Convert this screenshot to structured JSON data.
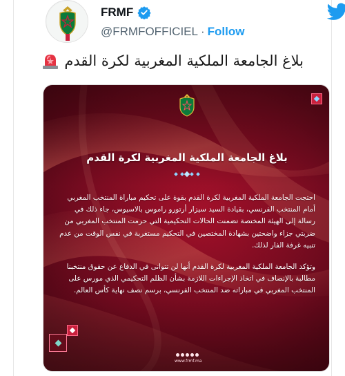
{
  "account": {
    "display_name": "FRMF",
    "handle": "@FRMFOFFICIEL",
    "separator": "·",
    "follow_label": "Follow"
  },
  "icons": {
    "verified": "verified-badge-icon",
    "platform": "twitter-bird-icon",
    "siren": "police-light-emoji-icon",
    "crest": "frmf-crest-icon"
  },
  "colors": {
    "link_blue": "#1d9bf0",
    "muted": "#536471",
    "media_red_dark": "#5b0a18",
    "media_red": "#b3122e"
  },
  "tweet": {
    "text": "بلاغ الجامعة الملكية المغربية لكرة القدم"
  },
  "media": {
    "title": "بلاغ الجامعة الملكية المغربية لكرة القدم",
    "paragraph_1": "احتجت الجامعة الملكية المغربية لكرة القدم بقوة على تحكيم مباراة المنتخب المغربي أمام المنتخب الفرنسي، بقيادة السيد سيزار أرتورو راموس بالاسيوس، جاء ذلك في رسالة إلى الهيئة المختصة تضمنت الحالات التحكيمية التي حرمت المنتخب المغربي من ضربتي جزاء واضحتين بشهادة المختصين في التحكيم مستغربة في نفس الوقت من عدم تنبيه غرفة الفار لذلك.",
    "paragraph_2": "وتؤكد الجامعة الملكية المغربية لكرة القدم أنها لن تتوانى في الدفاع عن حقوق منتخبنا مطالبة بالإنصاف في اتخاذ الإجراءات اللازمة بشأن الظلم التحكيمي الذي مورس على المنتخب المغربي في مباراته ضد المنتخب الفرنسي، برسم نصف نهاية كأس العالم.",
    "footer_handle": "www.frmf.ma"
  }
}
